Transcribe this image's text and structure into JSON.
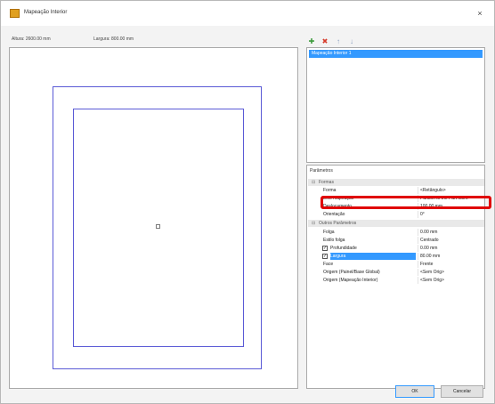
{
  "window": {
    "title": "Mapeação Interior",
    "close_glyph": "×"
  },
  "dimensions": {
    "height_text": "Altura: 2600.00 mm",
    "width_text": "Largura: 800.00 mm"
  },
  "toolbar": [
    {
      "name": "add-icon",
      "glyph": "✚",
      "color": "#3a9a3a"
    },
    {
      "name": "remove-icon",
      "glyph": "✖",
      "color": "#d63a2a"
    },
    {
      "name": "move-up-icon",
      "glyph": "↑",
      "color": "#8aa0c0"
    },
    {
      "name": "move-down-icon",
      "glyph": "↓",
      "color": "#8aa0c0"
    }
  ],
  "list": {
    "selected_item": "Mapeação Interior 1"
  },
  "parameters": {
    "title": "Parâmetros",
    "categories": {
      "forma": "Formas",
      "outros": "Outros Parâmetros"
    },
    "rows": {
      "forma_label": "Forma",
      "forma_value": "<Retângulo>",
      "eixo_label": "Eixo mapeação",
      "eixo_value": "Parallel to the Part Obro",
      "deslocamento_label": "Deslocamento",
      "deslocamento_value": "100.00 mm",
      "orientacao_label": "Orientação",
      "orientacao_value": "0°",
      "folga_label": "Folga",
      "folga_value": "0.00 mm",
      "estilo_folga_label": "Estilo folga",
      "estilo_folga_value": "Centrado",
      "profundidade_label": "Profundidade",
      "profundidade_value": "0.00 mm",
      "largura_label": "Largura",
      "largura_value": "80.00 mm",
      "face_label": "Face",
      "face_value": "Frente",
      "origem_global_label": "Origem (Painel/Base Global)",
      "origem_global_value": "<Sem Orig>",
      "origem_mapeacao_label": "Origem (Mapeação Interior)",
      "origem_mapeacao_value": "<Sem Orig>"
    }
  },
  "buttons": {
    "ok": "OK",
    "cancel": "Cancelar"
  },
  "colors": {
    "accent": "#3399ff",
    "outline": "#5a5ad6",
    "highlight": "#e00000"
  }
}
